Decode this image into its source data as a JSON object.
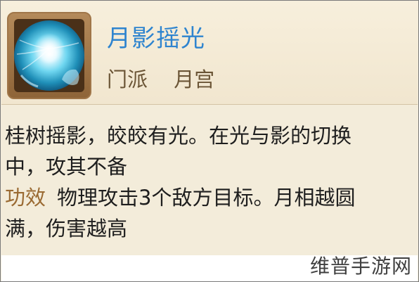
{
  "skill": {
    "icon": "moon-light-skill-icon",
    "name": "月影摇光",
    "sect_label": "门派",
    "sect_value": "月宫"
  },
  "description": {
    "line1": "桂树摇影，皎皎有光。在光与影的切换",
    "line2": "中，攻其不备"
  },
  "effect": {
    "label": "功效",
    "line1": "物理攻击3个敌方目标。月相越圆",
    "line2": "满，伤害越高"
  },
  "watermark": "维普手游网",
  "colors": {
    "title": "#2e84cf",
    "label": "#9a6a32",
    "panel_bg": "#f3ecda"
  }
}
